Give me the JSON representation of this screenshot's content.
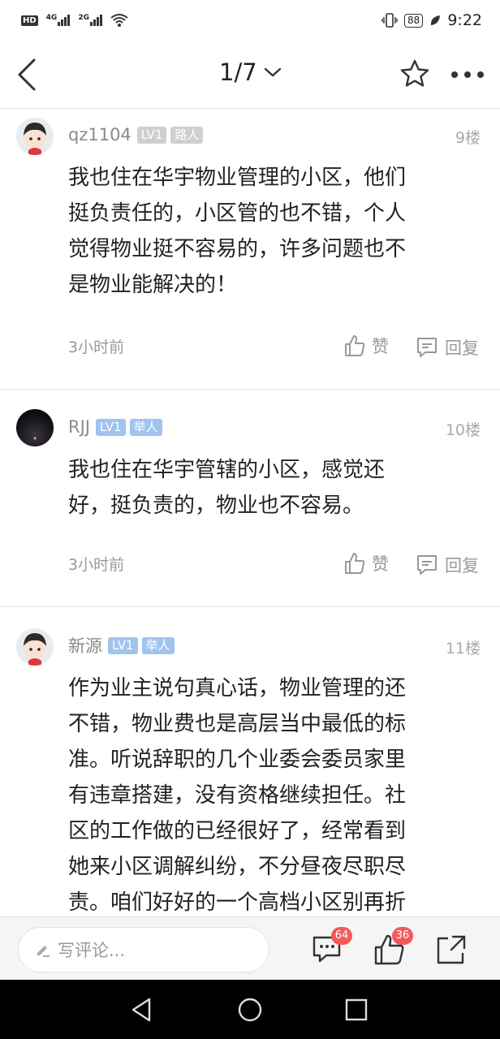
{
  "status_bar": {
    "time": "9:22",
    "battery": "88",
    "hd": "HD",
    "net1": "4G",
    "net2": "2G"
  },
  "nav": {
    "page_indicator": "1/7"
  },
  "posts": [
    {
      "username": "qz1104",
      "level": "LV1",
      "role": "路人",
      "floor": "9楼",
      "lines": [
        "我也住在华宇物业管理的小区，他们",
        "挺负责任的，小区管的也不错，个人",
        "觉得物业挺不容易的，许多问题也不",
        "是物业能解决的！"
      ],
      "time": "3小时前",
      "like_label": "赞",
      "reply_label": "回复"
    },
    {
      "username": "RJJ",
      "level": "LV1",
      "role": "举人",
      "floor": "10楼",
      "lines": [
        "我也住在华宇管辖的小区，感觉还",
        "好，挺负责的，物业也不容易。"
      ],
      "time": "3小时前",
      "like_label": "赞",
      "reply_label": "回复"
    },
    {
      "username": "新源",
      "level": "LV1",
      "role": "举人",
      "floor": "11楼",
      "lines": [
        "作为业主说句真心话，物业管理的还",
        "不错，物业费也是高层当中最低的标",
        "准。听说辞职的几个业委会委员家里",
        "有违章搭建，没有资格继续担任。社",
        "区的工作做的已经很好了，经常看到",
        "她来小区调解纠纷，不分昼夜尽职尽",
        "责。咱们好好的一个高档小区别再折"
      ]
    }
  ],
  "comment_bar": {
    "placeholder": "写评论...",
    "comment_count": "64",
    "like_count": "36"
  },
  "colors": {
    "accent_red": "#f25a5a",
    "badge_blue": "#9fc4ee",
    "badge_gray": "#cfcfcf"
  }
}
